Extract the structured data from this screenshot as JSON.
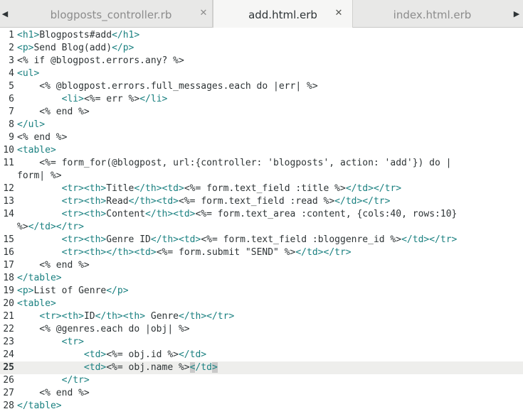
{
  "tabs": [
    {
      "label": "blogposts_controller.rb",
      "active": false
    },
    {
      "label": "add.html.erb",
      "active": true
    },
    {
      "label": "index.html.erb",
      "active": false
    }
  ],
  "close_glyph": "✕",
  "nav": {
    "left": "◀",
    "right": "▶"
  },
  "current_line": 25,
  "lines": [
    {
      "n": "1",
      "segments": [
        {
          "t": "<h1>",
          "c": "tag"
        },
        {
          "t": "Blogposts#add"
        },
        {
          "t": "</h1>",
          "c": "tag"
        }
      ]
    },
    {
      "n": "2",
      "segments": [
        {
          "t": "<p>",
          "c": "tag"
        },
        {
          "t": "Send Blog(add)"
        },
        {
          "t": "</p>",
          "c": "tag"
        }
      ]
    },
    {
      "n": "3",
      "segments": [
        {
          "t": "<% if @blogpost.errors.any? %>"
        }
      ]
    },
    {
      "n": "4",
      "segments": [
        {
          "t": "<ul>",
          "c": "tag"
        }
      ]
    },
    {
      "n": "5",
      "segments": [
        {
          "t": "    <% @blogpost.errors.full_messages.each do |err| %>"
        }
      ]
    },
    {
      "n": "6",
      "segments": [
        {
          "t": "        "
        },
        {
          "t": "<li>",
          "c": "tag"
        },
        {
          "t": "<%= err %>"
        },
        {
          "t": "</li>",
          "c": "tag"
        }
      ]
    },
    {
      "n": "7",
      "segments": [
        {
          "t": "    <% end %>"
        }
      ]
    },
    {
      "n": "8",
      "segments": [
        {
          "t": "</ul>",
          "c": "tag"
        }
      ]
    },
    {
      "n": "9",
      "segments": [
        {
          "t": "<% end %>"
        }
      ]
    },
    {
      "n": "10",
      "segments": [
        {
          "t": "<table>",
          "c": "tag"
        }
      ]
    },
    {
      "n": "11",
      "segments": [
        {
          "t": "    <%= form_for(@blogpost, url:{controller: 'blogposts', action: 'add'}) do |"
        }
      ]
    },
    {
      "n": "",
      "segments": [
        {
          "t": "form| %>"
        }
      ]
    },
    {
      "n": "12",
      "segments": [
        {
          "t": "        "
        },
        {
          "t": "<tr><th>",
          "c": "tag"
        },
        {
          "t": "Title"
        },
        {
          "t": "</th><td>",
          "c": "tag"
        },
        {
          "t": "<%= form.text_field :title %>"
        },
        {
          "t": "</td></tr>",
          "c": "tag"
        }
      ]
    },
    {
      "n": "13",
      "segments": [
        {
          "t": "        "
        },
        {
          "t": "<tr><th>",
          "c": "tag"
        },
        {
          "t": "Read"
        },
        {
          "t": "</th><td>",
          "c": "tag"
        },
        {
          "t": "<%= form.text_field :read %>"
        },
        {
          "t": "</td></tr>",
          "c": "tag"
        }
      ]
    },
    {
      "n": "14",
      "segments": [
        {
          "t": "        "
        },
        {
          "t": "<tr><th>",
          "c": "tag"
        },
        {
          "t": "Content"
        },
        {
          "t": "</th><td>",
          "c": "tag"
        },
        {
          "t": "<%= form.text_area :content, {cols:40, rows:10}"
        }
      ]
    },
    {
      "n": "",
      "segments": [
        {
          "t": "%>"
        },
        {
          "t": "</td></tr>",
          "c": "tag"
        }
      ]
    },
    {
      "n": "15",
      "segments": [
        {
          "t": "        "
        },
        {
          "t": "<tr><th>",
          "c": "tag"
        },
        {
          "t": "Genre ID"
        },
        {
          "t": "</th><td>",
          "c": "tag"
        },
        {
          "t": "<%= form.text_field :bloggenre_id %>"
        },
        {
          "t": "</td></tr>",
          "c": "tag"
        }
      ]
    },
    {
      "n": "16",
      "segments": [
        {
          "t": "        "
        },
        {
          "t": "<tr><th></th><td>",
          "c": "tag"
        },
        {
          "t": "<%= form.submit \"SEND\" %>"
        },
        {
          "t": "</td></tr>",
          "c": "tag"
        }
      ]
    },
    {
      "n": "17",
      "segments": [
        {
          "t": "    <% end %>"
        }
      ]
    },
    {
      "n": "18",
      "segments": [
        {
          "t": "</table>",
          "c": "tag"
        }
      ]
    },
    {
      "n": "19",
      "segments": [
        {
          "t": "<p>",
          "c": "tag"
        },
        {
          "t": "List of Genre"
        },
        {
          "t": "</p>",
          "c": "tag"
        }
      ]
    },
    {
      "n": "20",
      "segments": [
        {
          "t": "<table>",
          "c": "tag"
        }
      ]
    },
    {
      "n": "21",
      "segments": [
        {
          "t": "    "
        },
        {
          "t": "<tr><th>",
          "c": "tag"
        },
        {
          "t": "ID"
        },
        {
          "t": "</th><th>",
          "c": "tag"
        },
        {
          "t": " Genre"
        },
        {
          "t": "</th></tr>",
          "c": "tag"
        }
      ]
    },
    {
      "n": "22",
      "segments": [
        {
          "t": "    <% @genres.each do |obj| %>"
        }
      ]
    },
    {
      "n": "23",
      "segments": [
        {
          "t": "        "
        },
        {
          "t": "<tr>",
          "c": "tag"
        }
      ]
    },
    {
      "n": "24",
      "segments": [
        {
          "t": "            "
        },
        {
          "t": "<td>",
          "c": "tag"
        },
        {
          "t": "<%= obj.id %>"
        },
        {
          "t": "</td>",
          "c": "tag"
        }
      ]
    },
    {
      "n": "25",
      "segments": [
        {
          "t": "            "
        },
        {
          "t": "<td>",
          "c": "tag"
        },
        {
          "t": "<%= obj.name %>"
        },
        {
          "t": "<",
          "c": "hl-bracket"
        },
        {
          "t": "/td",
          "c": "tag"
        },
        {
          "t": ">",
          "c": "hl-bracket"
        }
      ]
    },
    {
      "n": "26",
      "segments": [
        {
          "t": "        "
        },
        {
          "t": "</tr>",
          "c": "tag"
        }
      ]
    },
    {
      "n": "27",
      "segments": [
        {
          "t": "    <% end %>"
        }
      ]
    },
    {
      "n": "28",
      "segments": [
        {
          "t": "</table>",
          "c": "tag"
        }
      ]
    }
  ]
}
